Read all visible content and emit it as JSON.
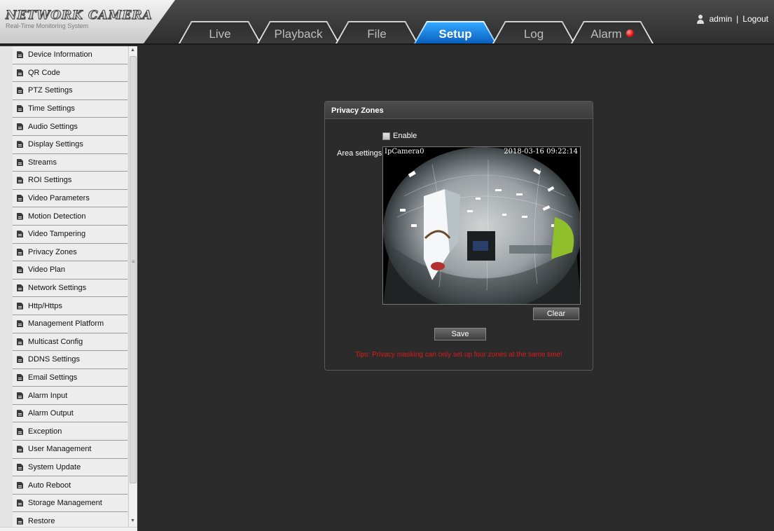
{
  "app": {
    "logo_title": "NETWORK CAMERA",
    "logo_subtitle": "Real-Time Monitoring System"
  },
  "tabs": [
    {
      "label": "Live",
      "active": false
    },
    {
      "label": "Playback",
      "active": false
    },
    {
      "label": "File",
      "active": false
    },
    {
      "label": "Setup",
      "active": true
    },
    {
      "label": "Log",
      "active": false
    },
    {
      "label": "Alarm",
      "active": false
    }
  ],
  "user": {
    "name": "admin",
    "separator": "|",
    "logout_label": "Logout"
  },
  "sidebar": {
    "items": [
      {
        "label": "Device Information"
      },
      {
        "label": "QR Code"
      },
      {
        "label": "PTZ Settings"
      },
      {
        "label": "Time Settings"
      },
      {
        "label": "Audio Settings"
      },
      {
        "label": "Display Settings"
      },
      {
        "label": "Streams"
      },
      {
        "label": "ROI Settings"
      },
      {
        "label": "Video Parameters"
      },
      {
        "label": "Motion Detection"
      },
      {
        "label": "Video Tampering"
      },
      {
        "label": "Privacy Zones"
      },
      {
        "label": "Video Plan"
      },
      {
        "label": "Network Settings"
      },
      {
        "label": "Http/Https"
      },
      {
        "label": "Management Platform"
      },
      {
        "label": "Multicast Config"
      },
      {
        "label": "DDNS Settings"
      },
      {
        "label": "Email Settings"
      },
      {
        "label": "Alarm Input"
      },
      {
        "label": "Alarm Output"
      },
      {
        "label": "Exception"
      },
      {
        "label": "User Management"
      },
      {
        "label": "System Update"
      },
      {
        "label": "Auto Reboot"
      },
      {
        "label": "Storage Management"
      },
      {
        "label": "Restore"
      }
    ]
  },
  "privacy": {
    "title": "Privacy Zones",
    "enable_label": "Enable",
    "enable_checked": false,
    "area_label": "Area settings:",
    "osd_name": "IpCamera0",
    "osd_time": "2018-03-16 09:22:14",
    "clear_label": "Clear",
    "save_label": "Save",
    "tips": "Tips: Privacy masking can only set up four zones at the same time!"
  },
  "colors": {
    "accent": "#1478d8",
    "tips": "#e01919",
    "background": "#2b2b2b"
  }
}
